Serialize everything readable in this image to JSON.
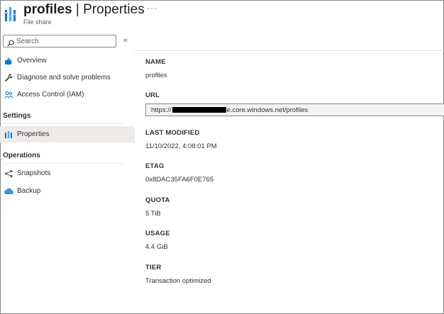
{
  "header": {
    "title_name": "profiles",
    "title_separator": "|",
    "title_page": "Properties",
    "subtitle": "File share",
    "more_label": "···"
  },
  "search": {
    "placeholder": "Search",
    "collapse_label": "«"
  },
  "sidebar": {
    "items": [
      {
        "label": "Overview",
        "icon": "overview-icon"
      },
      {
        "label": "Diagnose and solve problems",
        "icon": "wrench-icon"
      },
      {
        "label": "Access Control (IAM)",
        "icon": "people-icon"
      }
    ],
    "sections": [
      {
        "title": "Settings",
        "items": [
          {
            "label": "Properties",
            "icon": "properties-icon",
            "selected": true
          }
        ]
      },
      {
        "title": "Operations",
        "items": [
          {
            "label": "Snapshots",
            "icon": "snapshots-icon"
          },
          {
            "label": "Backup",
            "icon": "backup-icon"
          }
        ]
      }
    ]
  },
  "properties": {
    "name_label": "NAME",
    "name_value": "profiles",
    "url_label": "URL",
    "url_prefix": "https://",
    "url_suffix": "e.core.windows.net/profiles",
    "last_modified_label": "LAST MODIFIED",
    "last_modified_value": "11/10/2022, 4:08:01 PM",
    "etag_label": "ETAG",
    "etag_value": "0x8DAC35FA6F0E765",
    "quota_label": "QUOTA",
    "quota_value": "5 TiB",
    "usage_label": "USAGE",
    "usage_value": "4.4 GiB",
    "tier_label": "TIER",
    "tier_value": "Transaction optimized"
  },
  "colors": {
    "accent": "#0078d4",
    "selected_bg": "#edebe9",
    "text": "#323130"
  }
}
